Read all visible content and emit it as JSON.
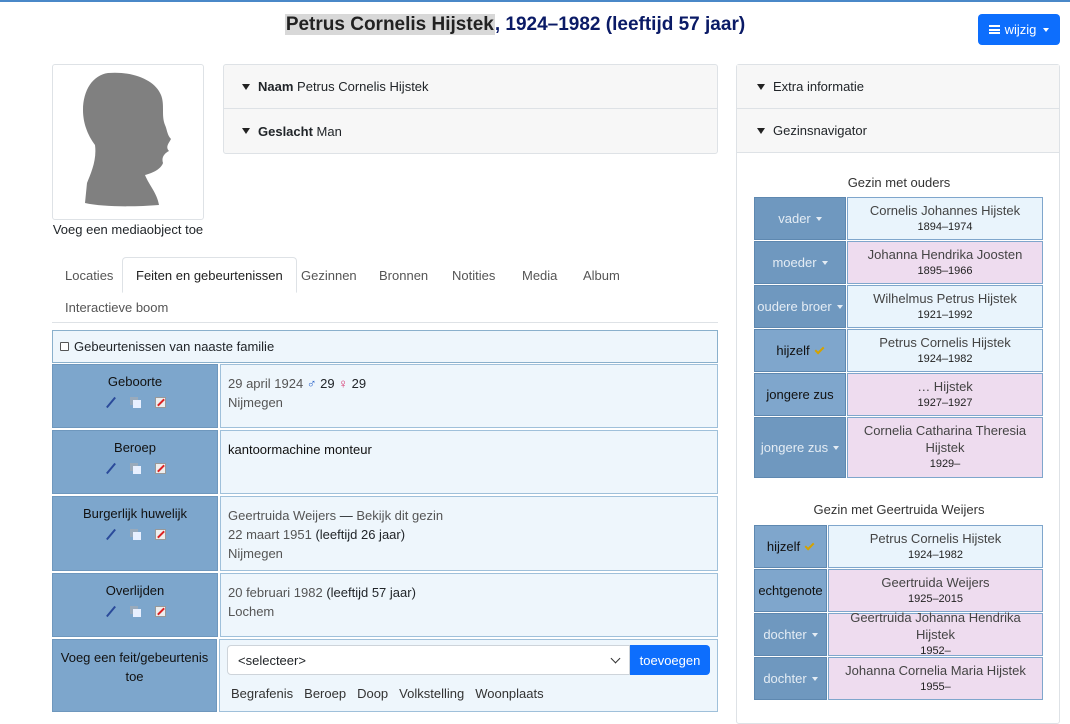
{
  "title": {
    "name": "Petrus Cornelis Hijstek",
    "rest": ", 1924–1982 (leeftijd 57 jaar)"
  },
  "edit_button": {
    "label": "wijzig",
    "icon": "menu-icon"
  },
  "media": {
    "add_label": "Voeg een mediaobject toe"
  },
  "summary": [
    {
      "label": "Naam",
      "value": "Petrus Cornelis Hijstek"
    },
    {
      "label": "Geslacht",
      "value": "Man"
    }
  ],
  "tabs": [
    "Locaties",
    "Feiten en gebeurtenissen",
    "Gezinnen",
    "Bronnen",
    "Notities",
    "Media",
    "Album",
    "Interactieve boom"
  ],
  "active_tab": "Feiten en gebeurtenissen",
  "family_events_label": "Gebeurtenissen van naaste familie",
  "facts": [
    {
      "label": "Geboorte",
      "line1": "29 april 1924",
      "father_age": "29",
      "mother_age": "29",
      "line2": "Nijmegen"
    },
    {
      "label": "Beroep",
      "line1": "kantoormachine monteur"
    },
    {
      "label": "Burgerlijk huwelijk",
      "spouse": "Geertruida Weijers",
      "dash": "—",
      "link": "Bekijk dit gezin",
      "date": "22 maart 1951",
      "age": "(leeftijd 26 jaar)",
      "place": "Nijmegen"
    },
    {
      "label": "Overlijden",
      "date": "20 februari 1982",
      "age": "(leeftijd 57 jaar)",
      "place": "Lochem"
    }
  ],
  "add_fact": {
    "label": "Voeg een feit/gebeurtenis toe",
    "select_value": "<selecteer>",
    "button": "toevoegen",
    "quick": [
      "Begrafenis",
      "Beroep",
      "Doop",
      "Volkstelling",
      "Woonplaats"
    ]
  },
  "sidebar": {
    "extra_label": "Extra informatie",
    "navigator_label": "Gezinsnavigator",
    "parents_family": {
      "title": "Gezin met ouders",
      "members": [
        {
          "role": "vader",
          "name": "Cornelis Johannes Hijstek",
          "dates": "1894–1974",
          "sex": "m"
        },
        {
          "role": "moeder",
          "name": "Johanna Hendrika Joosten",
          "dates": "1895–1966",
          "sex": "f"
        },
        {
          "role": "oudere broer",
          "name": "Wilhelmus Petrus Hijstek",
          "dates": "1921–1992",
          "sex": "m"
        },
        {
          "role": "hijzelf",
          "name": "Petrus Cornelis Hijstek",
          "dates": "1924–1982",
          "sex": "m"
        },
        {
          "role": "jongere zus",
          "name": "… Hijstek",
          "dates": "1927–1927",
          "sex": "f"
        },
        {
          "role": "jongere zus",
          "name": "Cornelia Catharina Theresia Hijstek",
          "dates": "1929–",
          "sex": "f"
        }
      ]
    },
    "own_family": {
      "title": "Gezin met Geertruida Weijers",
      "members": [
        {
          "role": "hijzelf",
          "name": "Petrus Cornelis Hijstek",
          "dates": "1924–1982",
          "sex": "m"
        },
        {
          "role": "echtgenote",
          "name": "Geertruida Weijers",
          "dates": "1925–2015",
          "sex": "f"
        },
        {
          "role": "dochter",
          "name": "Geertruida Johanna Hendrika Hijstek",
          "dates": "1952–",
          "sex": "f"
        },
        {
          "role": "dochter",
          "name": "Johanna Cornelia Maria Hijstek",
          "dates": "1955–",
          "sex": "f"
        }
      ]
    }
  },
  "colors": {
    "accent": "#0d6efd",
    "label_bg": "#7da6cc",
    "value_bg": "#eef6fc",
    "female_bg": "#eedcef"
  }
}
